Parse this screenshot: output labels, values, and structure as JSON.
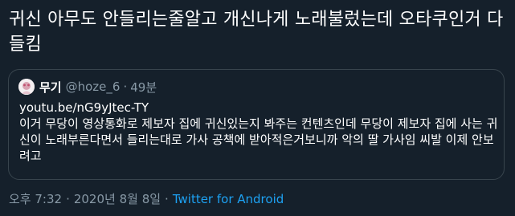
{
  "tweet": {
    "text": "귀신 아무도 안들리는줄알고 개신나게 노래불렀는데 오타쿠인거 다들킴"
  },
  "quote": {
    "display_name": "무기",
    "handle": "@hoze_6",
    "separator": "·",
    "time_ago": "49분",
    "link": "youtu.be/nG9yJtec-TY",
    "body": "이거 무당이 영상통화로 제보자 집에 귀신있는지 봐주는 컨텐츠인데 무당이 제보자 집에 사는 귀신이 노래부른다면서 들리는대로 가사 공책에 받아적은거보니까 악의 딸 가사임 씨발 이제 안보려고",
    "avatar_icon": "avatar-image"
  },
  "meta": {
    "time": "오후 7:32",
    "separator": "·",
    "date": "2020년 8월 8일",
    "source": "Twitter for Android",
    "source_color": "#1da1f2"
  }
}
